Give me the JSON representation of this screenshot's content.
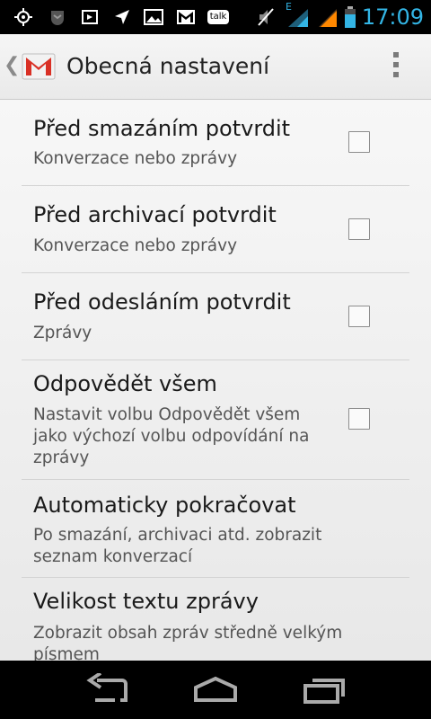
{
  "status_bar": {
    "time": "17:09",
    "network_type": "E",
    "icons": [
      "gps-icon",
      "android-icon",
      "sync-icon",
      "location-arrow-icon",
      "image-icon",
      "gmail-notification-icon",
      "talk-icon",
      "mute-icon",
      "signal-icon",
      "battery-icon"
    ],
    "talk_label": "talk",
    "accent_color": "#33b5e5"
  },
  "action_bar": {
    "title": "Obecná nastavení",
    "brand_color": "#d93025"
  },
  "settings": [
    {
      "title": "Před smazáním potvrdit",
      "summary": "Konverzace nebo zprávy",
      "checked": false
    },
    {
      "title": "Před archivací potvrdit",
      "summary": "Konverzace nebo zprávy",
      "checked": false
    },
    {
      "title": "Před odesláním potvrdit",
      "summary": "Zprávy",
      "checked": false
    },
    {
      "title": "Odpovědět všem",
      "summary": "Nastavit volbu Odpovědět všem jako výchozí volbu odpovídání na zprávy",
      "checked": false
    },
    {
      "title": "Automaticky pokračovat",
      "summary": "Po smazání, archivaci atd. zobrazit seznam konverzací"
    },
    {
      "title": "Velikost textu zprávy",
      "summary": "Zobrazit obsah zpráv středně velkým písmem"
    }
  ],
  "nav_bar": {
    "buttons": [
      "back-icon",
      "home-icon",
      "recent-apps-icon"
    ]
  }
}
